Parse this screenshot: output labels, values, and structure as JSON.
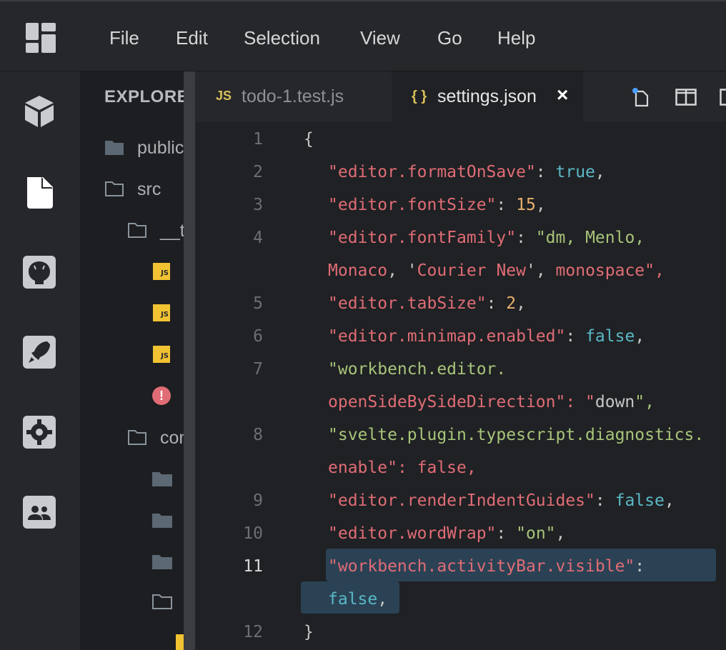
{
  "menu": {
    "items": [
      "File",
      "Edit",
      "Selection",
      "View",
      "Go",
      "Help"
    ]
  },
  "activity_bar": {
    "icons": [
      "cube-icon",
      "file-icon",
      "github-icon",
      "rocket-icon",
      "settings-icon",
      "team-icon"
    ]
  },
  "sidebar": {
    "title": "EXPLORER",
    "items": [
      {
        "label": "public",
        "type": "folder"
      },
      {
        "label": "src",
        "type": "folder-open"
      },
      {
        "label": "__tests__",
        "type": "folder-open"
      },
      {
        "label": "",
        "type": "js"
      },
      {
        "label": "",
        "type": "js"
      },
      {
        "label": "",
        "type": "js"
      },
      {
        "label": "",
        "type": "error"
      },
      {
        "label": "components",
        "type": "folder-open"
      },
      {
        "label": "",
        "type": "folder"
      },
      {
        "label": "",
        "type": "folder"
      },
      {
        "label": "",
        "type": "folder"
      },
      {
        "label": "",
        "type": "folder-open"
      }
    ]
  },
  "tabs": [
    {
      "label": "todo-1.test.js",
      "icon_text": "JS",
      "active": false
    },
    {
      "label": "settings.json",
      "icon_text": "{ }",
      "active": true,
      "close": "×"
    }
  ],
  "tab_actions": [
    "new-file-icon",
    "split-editor-icon",
    "more-layout-icon"
  ],
  "editor": {
    "current_line": 11,
    "line_numbers": [
      "1",
      "2",
      "3",
      "4",
      "5",
      "6",
      "7",
      "8",
      "9",
      "10",
      "11",
      "12"
    ],
    "lines": [
      "{",
      "\"editor.formatOnSave\": true,",
      "\"editor.fontSize\": 15,",
      "\"editor.fontFamily\": \"dm, Menlo, Monaco, 'Courier New', monospace\",",
      "\"editor.tabSize\": 2,",
      "\"editor.minimap.enabled\": false,",
      "\"workbench.editor.openSideBySideDirection\": \"down\",",
      "\"svelte.plugin.typescript.diagnostics.enable\": false,",
      "\"editor.renderIndentGuides\": false,",
      "\"editor.wordWrap\": \"on\",",
      "\"workbench.activityBar.visible\": false,",
      "}"
    ]
  },
  "colors": {
    "background": "#1f2124",
    "chrome": "#25272a",
    "key": "#e06c75",
    "string": "#a8c47a",
    "number": "#e8b06d",
    "boolean": "#5ab8c6",
    "selection": "#2b4255"
  }
}
